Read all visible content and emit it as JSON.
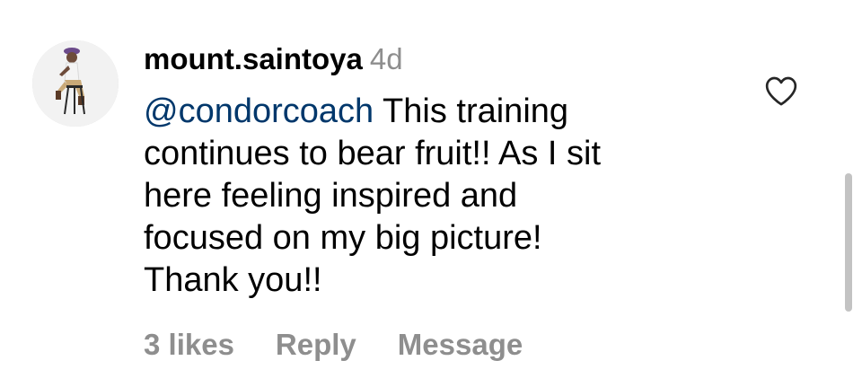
{
  "comment": {
    "avatar_icon": "profile-photo-person-sitting-on-stool",
    "username": "mount.saintoya",
    "time_ago": "4d",
    "mention": "@condorcoach",
    "text_line1": "This training",
    "text_line2": "continues to bear fruit!! As I sit",
    "text_line3": "here feeling inspired and",
    "text_line4": "focused on my big picture!",
    "text_line5": "Thank you!!",
    "likes_label": "3 likes",
    "reply_label": "Reply",
    "message_label": "Message",
    "like_icon": "heart-outline-icon"
  },
  "colors": {
    "mention": "#00376b",
    "secondary_text": "#8e8e8e",
    "text": "#000000",
    "scrollbar": "#c3c3c3"
  }
}
